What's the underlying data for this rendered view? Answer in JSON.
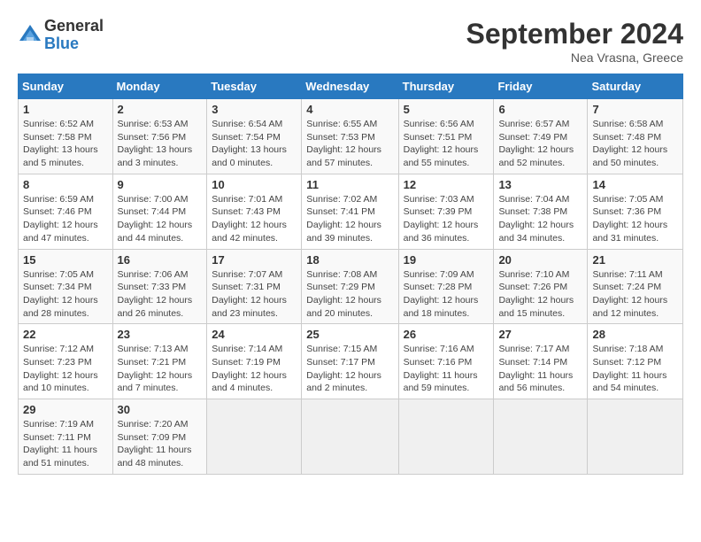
{
  "logo": {
    "general": "General",
    "blue": "Blue"
  },
  "title": "September 2024",
  "location": "Nea Vrasna, Greece",
  "headers": [
    "Sunday",
    "Monday",
    "Tuesday",
    "Wednesday",
    "Thursday",
    "Friday",
    "Saturday"
  ],
  "weeks": [
    [
      {
        "day": "1",
        "sunrise": "6:52 AM",
        "sunset": "7:58 PM",
        "daylight": "13 hours and 5 minutes."
      },
      {
        "day": "2",
        "sunrise": "6:53 AM",
        "sunset": "7:56 PM",
        "daylight": "13 hours and 3 minutes."
      },
      {
        "day": "3",
        "sunrise": "6:54 AM",
        "sunset": "7:54 PM",
        "daylight": "13 hours and 0 minutes."
      },
      {
        "day": "4",
        "sunrise": "6:55 AM",
        "sunset": "7:53 PM",
        "daylight": "12 hours and 57 minutes."
      },
      {
        "day": "5",
        "sunrise": "6:56 AM",
        "sunset": "7:51 PM",
        "daylight": "12 hours and 55 minutes."
      },
      {
        "day": "6",
        "sunrise": "6:57 AM",
        "sunset": "7:49 PM",
        "daylight": "12 hours and 52 minutes."
      },
      {
        "day": "7",
        "sunrise": "6:58 AM",
        "sunset": "7:48 PM",
        "daylight": "12 hours and 50 minutes."
      }
    ],
    [
      {
        "day": "8",
        "sunrise": "6:59 AM",
        "sunset": "7:46 PM",
        "daylight": "12 hours and 47 minutes."
      },
      {
        "day": "9",
        "sunrise": "7:00 AM",
        "sunset": "7:44 PM",
        "daylight": "12 hours and 44 minutes."
      },
      {
        "day": "10",
        "sunrise": "7:01 AM",
        "sunset": "7:43 PM",
        "daylight": "12 hours and 42 minutes."
      },
      {
        "day": "11",
        "sunrise": "7:02 AM",
        "sunset": "7:41 PM",
        "daylight": "12 hours and 39 minutes."
      },
      {
        "day": "12",
        "sunrise": "7:03 AM",
        "sunset": "7:39 PM",
        "daylight": "12 hours and 36 minutes."
      },
      {
        "day": "13",
        "sunrise": "7:04 AM",
        "sunset": "7:38 PM",
        "daylight": "12 hours and 34 minutes."
      },
      {
        "day": "14",
        "sunrise": "7:05 AM",
        "sunset": "7:36 PM",
        "daylight": "12 hours and 31 minutes."
      }
    ],
    [
      {
        "day": "15",
        "sunrise": "7:05 AM",
        "sunset": "7:34 PM",
        "daylight": "12 hours and 28 minutes."
      },
      {
        "day": "16",
        "sunrise": "7:06 AM",
        "sunset": "7:33 PM",
        "daylight": "12 hours and 26 minutes."
      },
      {
        "day": "17",
        "sunrise": "7:07 AM",
        "sunset": "7:31 PM",
        "daylight": "12 hours and 23 minutes."
      },
      {
        "day": "18",
        "sunrise": "7:08 AM",
        "sunset": "7:29 PM",
        "daylight": "12 hours and 20 minutes."
      },
      {
        "day": "19",
        "sunrise": "7:09 AM",
        "sunset": "7:28 PM",
        "daylight": "12 hours and 18 minutes."
      },
      {
        "day": "20",
        "sunrise": "7:10 AM",
        "sunset": "7:26 PM",
        "daylight": "12 hours and 15 minutes."
      },
      {
        "day": "21",
        "sunrise": "7:11 AM",
        "sunset": "7:24 PM",
        "daylight": "12 hours and 12 minutes."
      }
    ],
    [
      {
        "day": "22",
        "sunrise": "7:12 AM",
        "sunset": "7:23 PM",
        "daylight": "12 hours and 10 minutes."
      },
      {
        "day": "23",
        "sunrise": "7:13 AM",
        "sunset": "7:21 PM",
        "daylight": "12 hours and 7 minutes."
      },
      {
        "day": "24",
        "sunrise": "7:14 AM",
        "sunset": "7:19 PM",
        "daylight": "12 hours and 4 minutes."
      },
      {
        "day": "25",
        "sunrise": "7:15 AM",
        "sunset": "7:17 PM",
        "daylight": "12 hours and 2 minutes."
      },
      {
        "day": "26",
        "sunrise": "7:16 AM",
        "sunset": "7:16 PM",
        "daylight": "11 hours and 59 minutes."
      },
      {
        "day": "27",
        "sunrise": "7:17 AM",
        "sunset": "7:14 PM",
        "daylight": "11 hours and 56 minutes."
      },
      {
        "day": "28",
        "sunrise": "7:18 AM",
        "sunset": "7:12 PM",
        "daylight": "11 hours and 54 minutes."
      }
    ],
    [
      {
        "day": "29",
        "sunrise": "7:19 AM",
        "sunset": "7:11 PM",
        "daylight": "11 hours and 51 minutes."
      },
      {
        "day": "30",
        "sunrise": "7:20 AM",
        "sunset": "7:09 PM",
        "daylight": "11 hours and 48 minutes."
      },
      null,
      null,
      null,
      null,
      null
    ]
  ]
}
